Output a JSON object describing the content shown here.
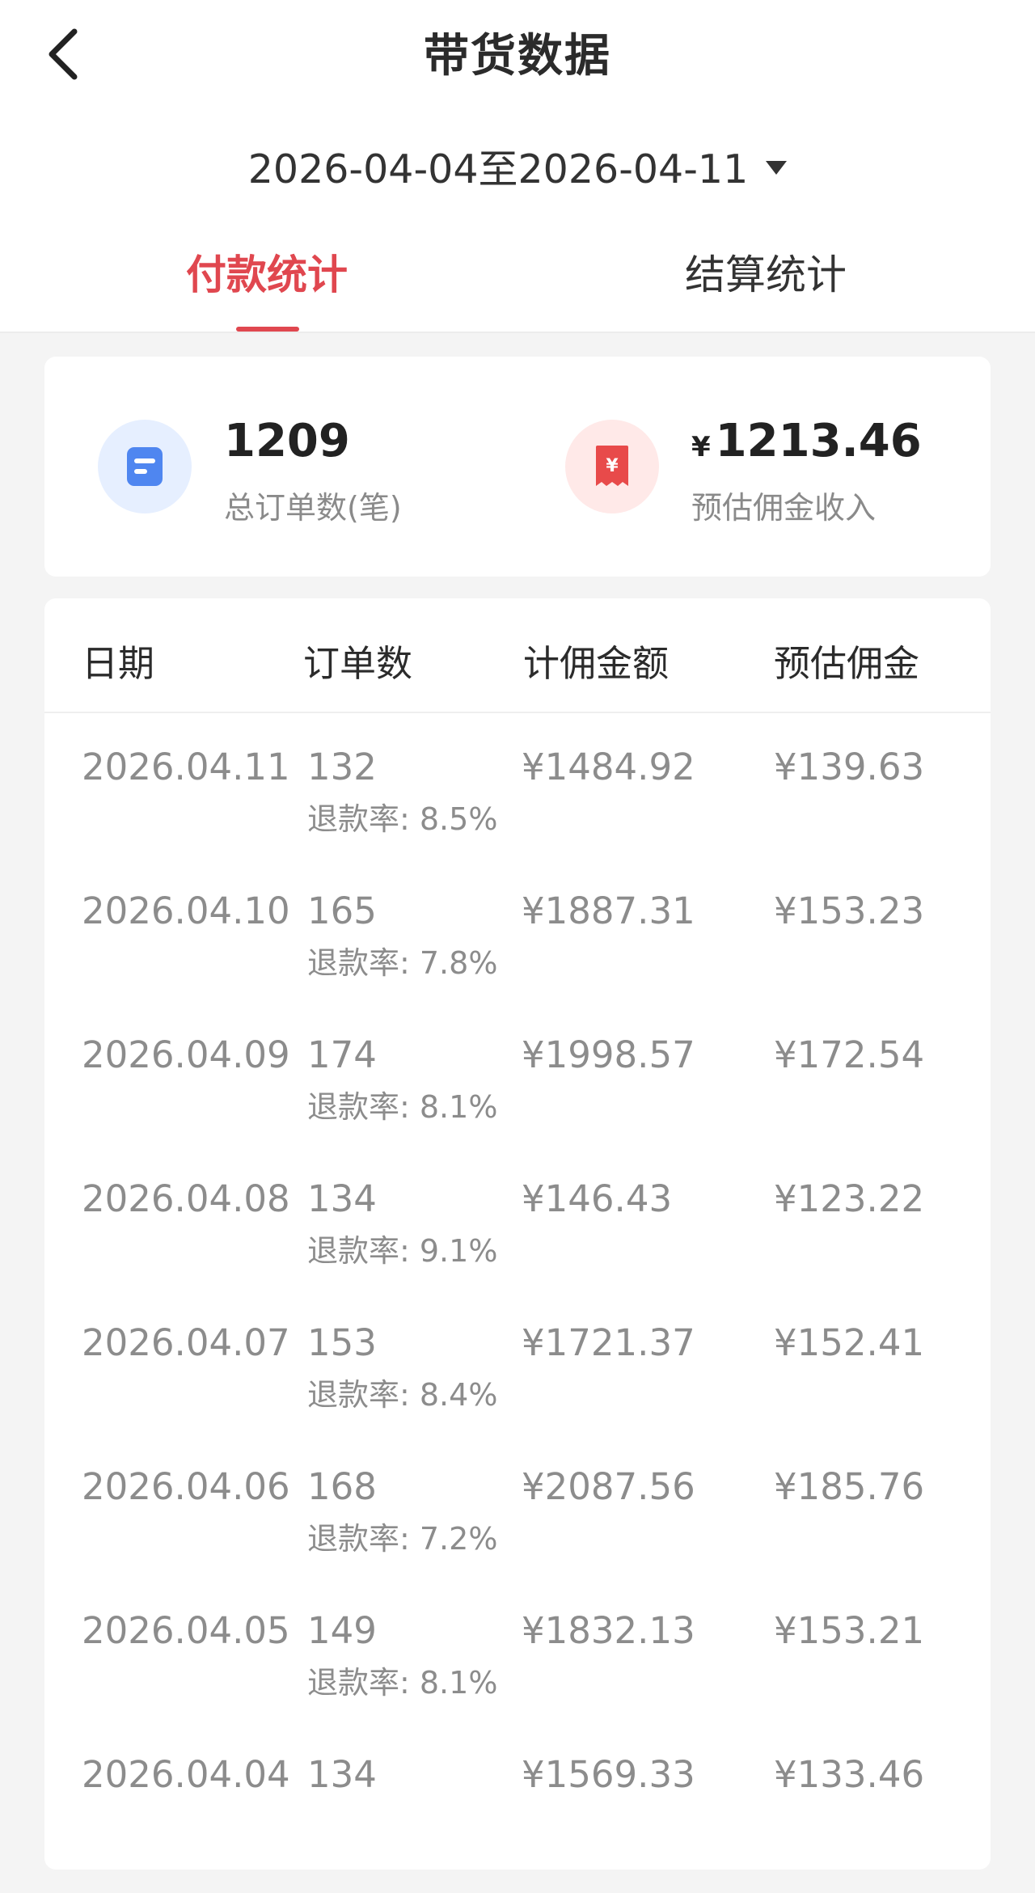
{
  "header": {
    "title": "带货数据",
    "date_range": "2026-04-04至2026-04-11"
  },
  "tabs": [
    {
      "label": "付款统计",
      "active": true
    },
    {
      "label": "结算统计",
      "active": false
    }
  ],
  "summary": {
    "total_orders": {
      "value": "1209",
      "label": "总订单数(笔)",
      "icon": "document-icon"
    },
    "estimated_commission": {
      "currency": "¥",
      "value": "1213.46",
      "label": "预估佣金收入",
      "icon": "receipt-yen-icon"
    }
  },
  "table": {
    "columns": [
      "日期",
      "订单数",
      "计佣金额",
      "预估佣金"
    ],
    "rows": [
      {
        "date": "2026.04.11",
        "orders": "132",
        "refund": "退款率: 8.5%",
        "amount": "¥1484.92",
        "commission": "¥139.63"
      },
      {
        "date": "2026.04.10",
        "orders": "165",
        "refund": "退款率: 7.8%",
        "amount": "¥1887.31",
        "commission": "¥153.23"
      },
      {
        "date": "2026.04.09",
        "orders": "174",
        "refund": "退款率: 8.1%",
        "amount": "¥1998.57",
        "commission": "¥172.54"
      },
      {
        "date": "2026.04.08",
        "orders": "134",
        "refund": "退款率: 9.1%",
        "amount": "¥146.43",
        "commission": "¥123.22"
      },
      {
        "date": "2026.04.07",
        "orders": "153",
        "refund": "退款率: 8.4%",
        "amount": "¥1721.37",
        "commission": "¥152.41"
      },
      {
        "date": "2026.04.06",
        "orders": "168",
        "refund": "退款率: 7.2%",
        "amount": "¥2087.56",
        "commission": "¥185.76"
      },
      {
        "date": "2026.04.05",
        "orders": "149",
        "refund": "退款率: 8.1%",
        "amount": "¥1832.13",
        "commission": "¥153.21"
      },
      {
        "date": "2026.04.04",
        "orders": "134",
        "refund": "",
        "amount": "¥1569.33",
        "commission": "¥133.46"
      }
    ]
  },
  "colors": {
    "accent": "#e0474f",
    "orders_icon": "#4f86f0",
    "commission_icon": "#e84a4a"
  }
}
